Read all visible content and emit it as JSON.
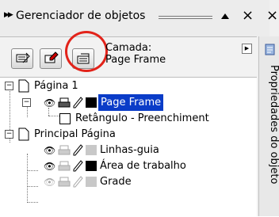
{
  "window": {
    "title": "Gerenciador de objetos",
    "close_glyph": "×"
  },
  "layer_box": {
    "label": "Camada:",
    "value": "Page Frame"
  },
  "side_tab": {
    "label": "Propriedades do objeto"
  },
  "tree": {
    "page1": {
      "label": "Página 1",
      "children": [
        {
          "label": "Page Frame",
          "selected": true,
          "color": "#000000"
        },
        {
          "label": "Retângulo - Preenchiment"
        }
      ]
    },
    "master": {
      "label": "Principal Página",
      "children": [
        {
          "label": "Linhas-guia",
          "color": "#c8c8c8"
        },
        {
          "label": "Área de trabalho",
          "color": "#000000"
        },
        {
          "label": "Grade",
          "color": "#c8c8c8"
        }
      ]
    }
  },
  "colors": {
    "accent": "#0a3cc8",
    "highlight_circle": "#e2231a"
  }
}
